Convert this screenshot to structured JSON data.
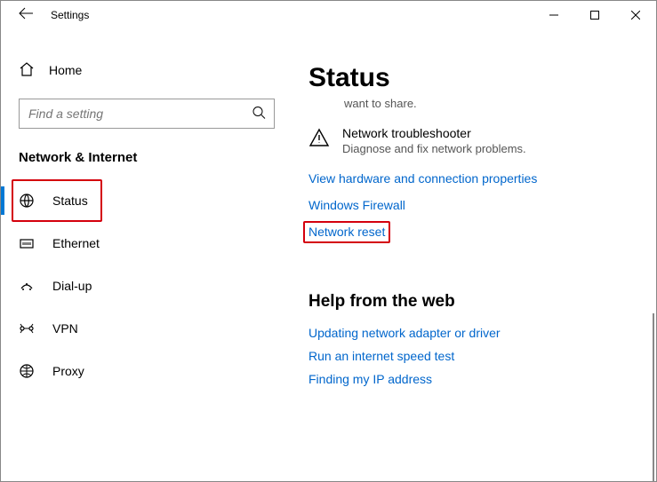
{
  "window": {
    "title": "Settings"
  },
  "sidebar": {
    "home_label": "Home",
    "search_placeholder": "Find a setting",
    "category": "Network & Internet",
    "items": [
      {
        "label": "Status"
      },
      {
        "label": "Ethernet"
      },
      {
        "label": "Dial-up"
      },
      {
        "label": "VPN"
      },
      {
        "label": "Proxy"
      }
    ]
  },
  "main": {
    "title": "Status",
    "clipped_text": "want to share.",
    "troubleshooter": {
      "title": "Network troubleshooter",
      "subtitle": "Diagnose and fix network problems."
    },
    "links": {
      "hardware": "View hardware and connection properties",
      "firewall": "Windows Firewall",
      "reset": "Network reset"
    },
    "help": {
      "title": "Help from the web",
      "links": [
        "Updating network adapter or driver",
        "Run an internet speed test",
        "Finding my IP address"
      ]
    }
  }
}
